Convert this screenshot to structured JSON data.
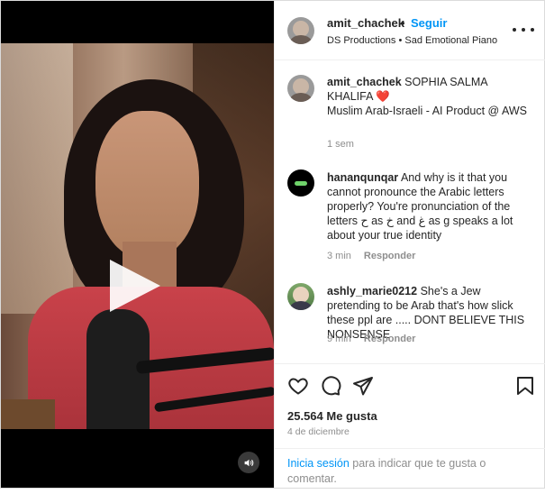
{
  "post": {
    "username": "amit_chachek",
    "separator": "•",
    "follow_label": "Seguir",
    "subtitle": "DS Productions • Sad Emotional Piano"
  },
  "caption": {
    "username": "amit_chachek",
    "text": "SOPHIA SALMA KHALIFA",
    "heart": "❤️",
    "line2": "Muslim Arab-Israeli - AI Product @ AWS",
    "time": "1 sem"
  },
  "comments": [
    {
      "username": "hananqunqar",
      "text": "And why is it that you cannot pronounce the Arabic letters properly? You're pronunciation of the letters ح as خ and غ as g speaks a lot about your true identity",
      "time": "3 min",
      "reply": "Responder"
    },
    {
      "username": "ashly_marie0212",
      "text": "She's a Jew pretending to be Arab that's how slick these ppl are ..... DONT BELIEVE THIS NONSENSE",
      "time": "9 min",
      "reply": "Responder"
    }
  ],
  "stats": {
    "likes": "25.564 Me gusta",
    "date": "4 de diciembre"
  },
  "login": {
    "link": "Inicia sesión",
    "rest": "para indicar que te gusta o comentar."
  },
  "icons": {
    "like": "heart-icon",
    "comment": "comment-icon",
    "share": "share-icon",
    "save": "bookmark-icon",
    "volume": "volume-icon",
    "play": "play-icon",
    "more": "more-options-icon"
  },
  "colors": {
    "accent": "#0095f6",
    "heart": "#ed4956"
  }
}
